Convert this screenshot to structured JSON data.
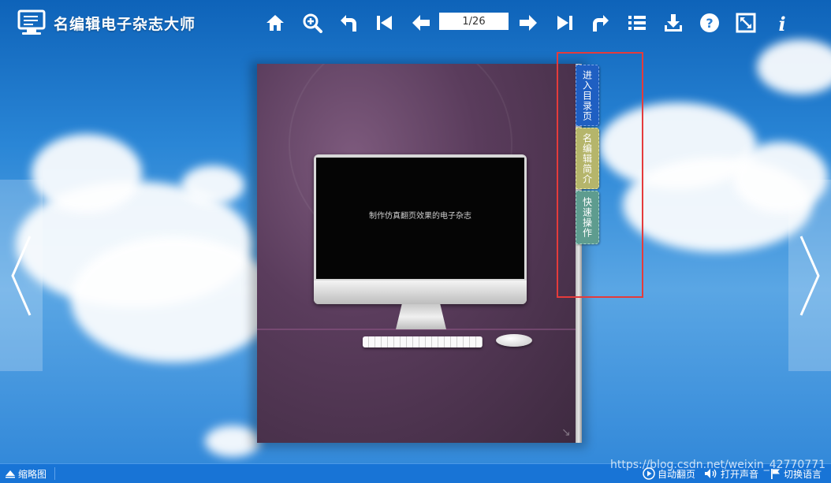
{
  "app": {
    "logo_text": "名编辑电子杂志大师"
  },
  "toolbar": {
    "page_indicator": "1/26",
    "icons": [
      "home-icon",
      "zoom-in-icon",
      "undo-icon",
      "first-page-icon",
      "prev-page-icon",
      "next-page-icon",
      "last-page-icon",
      "redo-icon",
      "list-icon",
      "download-icon",
      "help-icon",
      "fullscreen-icon",
      "info-icon"
    ]
  },
  "book": {
    "screen_text": "制作仿真翻页效果的电子杂志"
  },
  "tabs": [
    {
      "label": "进入目录页",
      "color": "#1f5fc2"
    },
    {
      "label": "名编辑简介",
      "color": "#b5b56b"
    },
    {
      "label": "快速操作",
      "color": "#5e9c8f"
    }
  ],
  "bottombar": {
    "thumbnails": "缩略图",
    "auto_flip": "自动翻页",
    "sound": "打开声音",
    "language": "切换语言"
  },
  "watermark": "https://blog.csdn.net/weixin_42770771",
  "colors": {
    "highlight": "#e53b3b",
    "bottombar": "#1874d6"
  }
}
